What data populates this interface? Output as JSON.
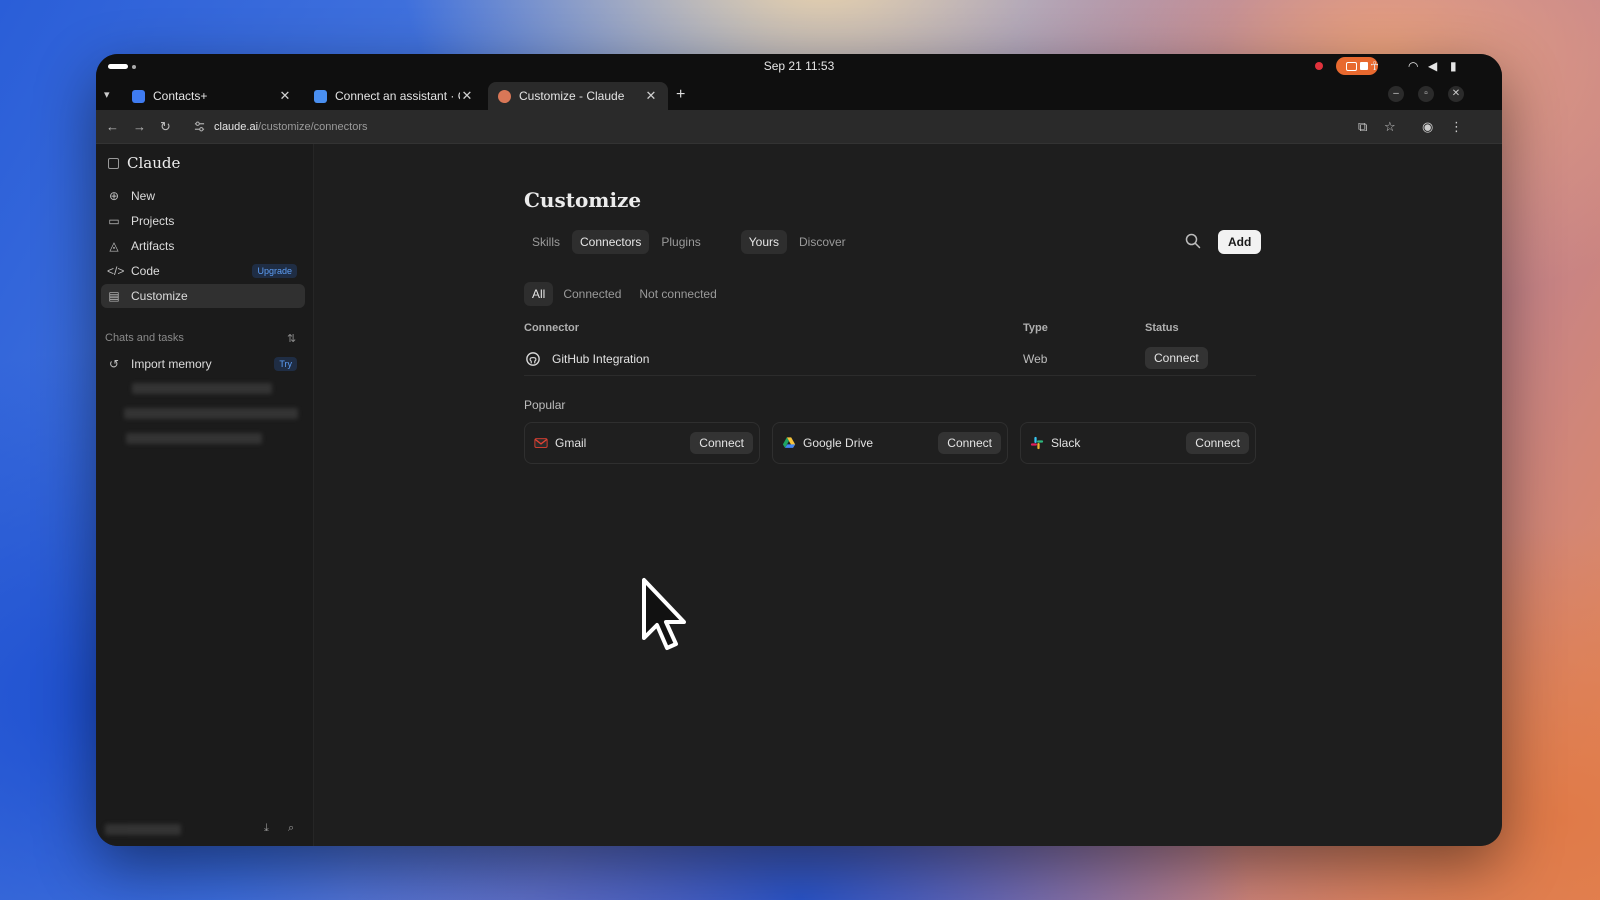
{
  "os": {
    "clock": "Sep 21  11:53"
  },
  "browser": {
    "tabs": [
      {
        "title": "Contacts+",
        "favicon_color": "#3f7bf0"
      },
      {
        "title": "Connect an assistant · Co",
        "favicon_color": "#4a8ff0"
      },
      {
        "title": "Customize - Claude",
        "favicon_color": "#d97757",
        "active": true
      }
    ],
    "url_host": "claude.ai",
    "url_path": "/customize/connectors"
  },
  "sidebar": {
    "brand": "Claude",
    "items": [
      {
        "label": "New",
        "icon": "plus-icon"
      },
      {
        "label": "Projects",
        "icon": "folder-icon"
      },
      {
        "label": "Artifacts",
        "icon": "shapes-icon"
      },
      {
        "label": "Code",
        "icon": "code-icon",
        "badge": "Upgrade"
      },
      {
        "label": "Customize",
        "icon": "briefcase-icon",
        "active": true
      }
    ],
    "section_label": "Chats and tasks",
    "import_memory": {
      "label": "Import memory",
      "badge": "Try"
    }
  },
  "main": {
    "title": "Customize",
    "tabs": [
      {
        "label": "Skills"
      },
      {
        "label": "Connectors",
        "active": true
      },
      {
        "label": "Plugins"
      }
    ],
    "scope_tabs": [
      {
        "label": "Yours",
        "active": true
      },
      {
        "label": "Discover"
      }
    ],
    "add_label": "Add",
    "filters": [
      {
        "label": "All",
        "active": true
      },
      {
        "label": "Connected"
      },
      {
        "label": "Not connected"
      }
    ],
    "table": {
      "headers": {
        "connector": "Connector",
        "type": "Type",
        "status": "Status"
      },
      "rows": [
        {
          "name": "GitHub Integration",
          "type": "Web",
          "action": "Connect",
          "icon": "github-icon"
        }
      ]
    },
    "popular_label": "Popular",
    "popular": [
      {
        "name": "Gmail",
        "action": "Connect",
        "icon": "gmail-icon"
      },
      {
        "name": "Google Drive",
        "action": "Connect",
        "icon": "google-drive-icon"
      },
      {
        "name": "Slack",
        "action": "Connect",
        "icon": "slack-icon"
      }
    ]
  },
  "colors": {
    "background": "#1e1e1e",
    "sidebar": "#1b1b1b",
    "accent_badge": "#5d9ef5",
    "recording": "#e0323c",
    "cast_pill": "#e8692f"
  }
}
